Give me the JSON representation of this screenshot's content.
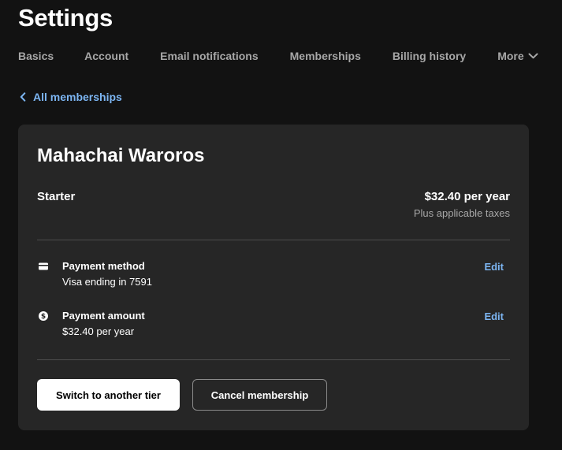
{
  "page": {
    "title": "Settings"
  },
  "tabs": [
    {
      "label": "Basics"
    },
    {
      "label": "Account"
    },
    {
      "label": "Email notifications"
    },
    {
      "label": "Memberships"
    },
    {
      "label": "Billing history"
    },
    {
      "label": "More",
      "icon": "chevron-down-icon"
    }
  ],
  "back_link": {
    "label": "All memberships",
    "icon": "chevron-left-icon"
  },
  "membership": {
    "creator_name": "Mahachai Waroros",
    "tier_name": "Starter",
    "price": "$32.40 per year",
    "tax_note": "Plus applicable taxes",
    "payment_method": {
      "icon": "credit-card-icon",
      "title": "Payment method",
      "value": "Visa ending in 7591",
      "edit_label": "Edit"
    },
    "payment_amount": {
      "icon": "dollar-coin-icon",
      "title": "Payment amount",
      "value": "$32.40 per year",
      "edit_label": "Edit"
    },
    "switch_tier_label": "Switch to another tier",
    "cancel_label": "Cancel membership"
  },
  "colors": {
    "background": "#121212",
    "card": "#262626",
    "accent_link": "#7cb5f2",
    "tab_text": "#a7a7a7"
  }
}
